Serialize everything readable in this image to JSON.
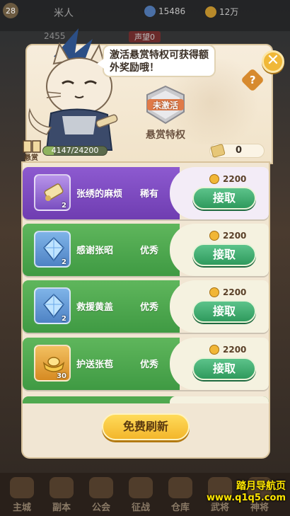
{
  "topbar": {
    "level": "28",
    "player_name": "米人",
    "currency_1": "15486",
    "currency_2": "12万",
    "power": "2455",
    "rank_label": "声望0"
  },
  "panel": {
    "bubble_text": "激活悬赏特权可获得额外奖励哦！",
    "privilege_state": "未激活",
    "privilege_label": "悬赏特权",
    "bounty_label": "悬赏",
    "progress_text": "4147/24200",
    "progress_fraction": 0.171,
    "token_value": "0",
    "close_symbol": "✕",
    "help_symbol": "?"
  },
  "quests": [
    {
      "name": "张绣的麻烦",
      "rarity": "稀有",
      "qty": "2",
      "reward": "2200",
      "button": "接取",
      "item_icon": "scroll-icon",
      "color": "#8d5ad0"
    },
    {
      "name": "感谢张昭",
      "rarity": "优秀",
      "qty": "2",
      "reward": "2200",
      "button": "接取",
      "item_icon": "crystal-icon",
      "color": "#4fa94f"
    },
    {
      "name": "救援黄盖",
      "rarity": "优秀",
      "qty": "2",
      "reward": "2200",
      "button": "接取",
      "item_icon": "crystal-icon",
      "color": "#4fa94f"
    },
    {
      "name": "护送张苞",
      "rarity": "优秀",
      "qty": "30",
      "reward": "2200",
      "button": "接取",
      "item_icon": "gold-ingot-icon",
      "color": "#4fa94f"
    }
  ],
  "refresh_button": "免费刷新",
  "bottom_nav": [
    "主城",
    "副本",
    "公会",
    "征战",
    "仓库",
    "武将",
    "神将"
  ],
  "watermark": {
    "line1": "踏月导航页",
    "line2": "www.q1q5.com"
  }
}
